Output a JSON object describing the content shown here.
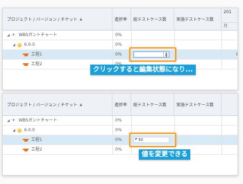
{
  "grid": {
    "headers": {
      "tree": "プロジェクト / バージョン / チケット",
      "sort_indicator": "▲",
      "progress": "進捗率",
      "planned_cases": "総テストケース数",
      "actual_cases": "実施テストケース数",
      "year": "201",
      "month": "月"
    },
    "rows": [
      {
        "label": "WBSガントチャート",
        "progress": "0%",
        "icon": "pin-icon",
        "twisty": "◢"
      },
      {
        "label": "6.0.0",
        "progress": "0%",
        "icon": "version-icon",
        "twisty": "◢"
      },
      {
        "label": "工程1",
        "progress": "0%",
        "icon": "task-icon"
      },
      {
        "label": "工程2",
        "progress": "0%",
        "icon": "task-icon"
      }
    ]
  },
  "panel1": {
    "callout": "クリックすると編集状態になり...",
    "spinner_up": "▲",
    "spinner_down": "▼",
    "edge_mark": "8"
  },
  "panel2": {
    "edit_value": "30",
    "callout": "値を変更できる"
  },
  "colors": {
    "callout_bg": "#1b9fd8",
    "highlight": "#f0a030",
    "selected_row": "#d8e9f6"
  }
}
